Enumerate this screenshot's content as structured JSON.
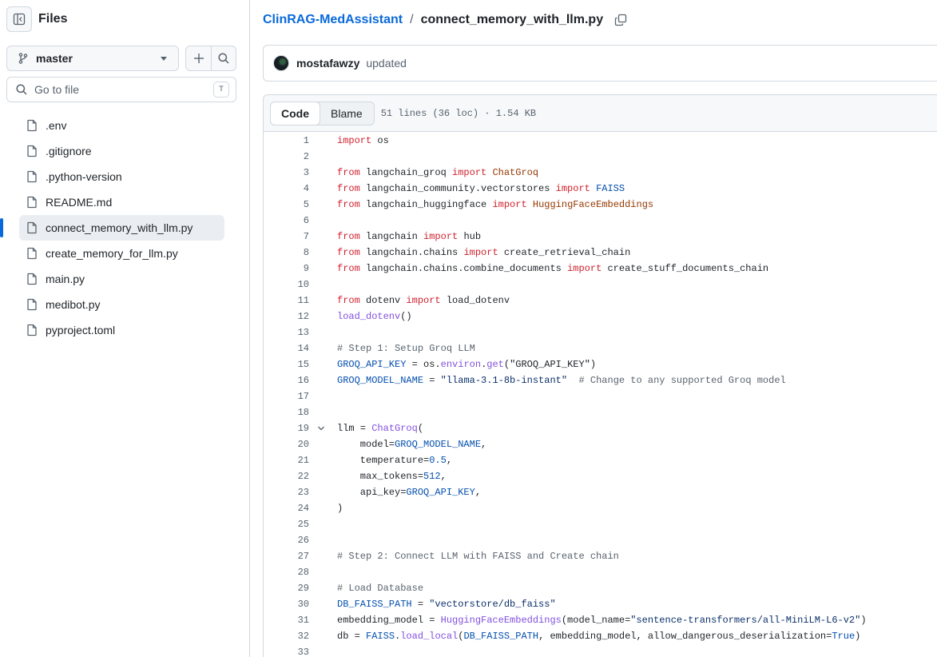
{
  "sidebar": {
    "title": "Files",
    "branch": "master",
    "search_placeholder": "Go to file",
    "search_shortcut": "T",
    "files": [
      {
        "name": ".env",
        "active": false
      },
      {
        "name": ".gitignore",
        "active": false
      },
      {
        "name": ".python-version",
        "active": false
      },
      {
        "name": "README.md",
        "active": false
      },
      {
        "name": "connect_memory_with_llm.py",
        "active": true
      },
      {
        "name": "create_memory_for_llm.py",
        "active": false
      },
      {
        "name": "main.py",
        "active": false
      },
      {
        "name": "medibot.py",
        "active": false
      },
      {
        "name": "pyproject.toml",
        "active": false
      }
    ]
  },
  "breadcrumb": {
    "repo": "ClinRAG-MedAssistant",
    "separator": "/",
    "file": "connect_memory_with_llm.py"
  },
  "commit": {
    "author": "mostafawzy",
    "message": "updated"
  },
  "file_header": {
    "tab_code": "Code",
    "tab_blame": "Blame",
    "info": "51 lines (36 loc) · 1.54 KB"
  },
  "code_lines": [
    {
      "n": "1",
      "t": [
        [
          "k",
          "import"
        ],
        [
          "p",
          " os"
        ]
      ]
    },
    {
      "n": "2",
      "t": []
    },
    {
      "n": "3",
      "t": [
        [
          "k",
          "from"
        ],
        [
          "p",
          " langchain_groq "
        ],
        [
          "k",
          "import"
        ],
        [
          "p",
          " "
        ],
        [
          "cl",
          "ChatGroq"
        ]
      ]
    },
    {
      "n": "4",
      "t": [
        [
          "k",
          "from"
        ],
        [
          "p",
          " langchain_community.vectorstores "
        ],
        [
          "k",
          "import"
        ],
        [
          "p",
          " "
        ],
        [
          "n",
          "FAISS"
        ]
      ]
    },
    {
      "n": "5",
      "t": [
        [
          "k",
          "from"
        ],
        [
          "p",
          " langchain_huggingface "
        ],
        [
          "k",
          "import"
        ],
        [
          "p",
          " "
        ],
        [
          "cl",
          "HuggingFaceEmbeddings"
        ]
      ]
    },
    {
      "n": "6",
      "t": []
    },
    {
      "n": "7",
      "t": [
        [
          "k",
          "from"
        ],
        [
          "p",
          " langchain "
        ],
        [
          "k",
          "import"
        ],
        [
          "p",
          " hub"
        ]
      ]
    },
    {
      "n": "8",
      "t": [
        [
          "k",
          "from"
        ],
        [
          "p",
          " langchain.chains "
        ],
        [
          "k",
          "import"
        ],
        [
          "p",
          " create_retrieval_chain"
        ]
      ]
    },
    {
      "n": "9",
      "t": [
        [
          "k",
          "from"
        ],
        [
          "p",
          " langchain.chains.combine_documents "
        ],
        [
          "k",
          "import"
        ],
        [
          "p",
          " create_stuff_documents_chain"
        ]
      ]
    },
    {
      "n": "10",
      "t": []
    },
    {
      "n": "11",
      "t": [
        [
          "k",
          "from"
        ],
        [
          "p",
          " dotenv "
        ],
        [
          "k",
          "import"
        ],
        [
          "p",
          " load_dotenv"
        ]
      ]
    },
    {
      "n": "12",
      "t": [
        [
          "f",
          "load_dotenv"
        ],
        [
          "p",
          "()"
        ]
      ]
    },
    {
      "n": "13",
      "t": []
    },
    {
      "n": "14",
      "t": [
        [
          "c",
          "# Step 1: Setup Groq LLM"
        ]
      ]
    },
    {
      "n": "15",
      "t": [
        [
          "n",
          "GROQ_API_KEY"
        ],
        [
          "p",
          " = os."
        ],
        [
          "f",
          "environ"
        ],
        [
          "p",
          "."
        ],
        [
          "f",
          "get"
        ],
        [
          "p",
          "(\"GROQ_API_KEY\")"
        ]
      ]
    },
    {
      "n": "16",
      "t": [
        [
          "n",
          "GROQ_MODEL_NAME"
        ],
        [
          "p",
          " = "
        ],
        [
          "s",
          "\"llama-3.1-8b-instant\""
        ],
        [
          "p",
          "  "
        ],
        [
          "c",
          "# Change to any supported Groq model"
        ]
      ]
    },
    {
      "n": "17",
      "t": []
    },
    {
      "n": "18",
      "t": []
    },
    {
      "n": "19",
      "t": [
        [
          "p",
          "llm = "
        ],
        [
          "f",
          "ChatGroq"
        ],
        [
          "p",
          "("
        ]
      ],
      "fold": true
    },
    {
      "n": "20",
      "t": [
        [
          "p",
          "    model="
        ],
        [
          "n",
          "GROQ_MODEL_NAME"
        ],
        [
          "p",
          ","
        ]
      ]
    },
    {
      "n": "21",
      "t": [
        [
          "p",
          "    temperature="
        ],
        [
          "n",
          "0.5"
        ],
        [
          "p",
          ","
        ]
      ]
    },
    {
      "n": "22",
      "t": [
        [
          "p",
          "    max_tokens="
        ],
        [
          "n",
          "512"
        ],
        [
          "p",
          ","
        ]
      ]
    },
    {
      "n": "23",
      "t": [
        [
          "p",
          "    api_key="
        ],
        [
          "n",
          "GROQ_API_KEY"
        ],
        [
          "p",
          ","
        ]
      ]
    },
    {
      "n": "24",
      "t": [
        [
          "p",
          ")"
        ]
      ]
    },
    {
      "n": "25",
      "t": []
    },
    {
      "n": "26",
      "t": []
    },
    {
      "n": "27",
      "t": [
        [
          "c",
          "# Step 2: Connect LLM with FAISS and Create chain"
        ]
      ]
    },
    {
      "n": "28",
      "t": []
    },
    {
      "n": "29",
      "t": [
        [
          "c",
          "# Load Database"
        ]
      ]
    },
    {
      "n": "30",
      "t": [
        [
          "n",
          "DB_FAISS_PATH"
        ],
        [
          "p",
          " = "
        ],
        [
          "s",
          "\"vectorstore/db_faiss\""
        ]
      ]
    },
    {
      "n": "31",
      "t": [
        [
          "p",
          "embedding_model = "
        ],
        [
          "f",
          "HuggingFaceEmbeddings"
        ],
        [
          "p",
          "(model_name="
        ],
        [
          "s",
          "\"sentence-transformers/all-MiniLM-L6-v2\""
        ],
        [
          "p",
          ")"
        ]
      ]
    },
    {
      "n": "32",
      "t": [
        [
          "p",
          "db = "
        ],
        [
          "n",
          "FAISS"
        ],
        [
          "p",
          "."
        ],
        [
          "f",
          "load_local"
        ],
        [
          "p",
          "("
        ],
        [
          "n",
          "DB_FAISS_PATH"
        ],
        [
          "p",
          ", embedding_model, allow_dangerous_deserialization="
        ],
        [
          "n",
          "True"
        ],
        [
          "p",
          ")"
        ]
      ]
    },
    {
      "n": "33",
      "t": []
    }
  ],
  "icons": {
    "collapse": "sidebar-collapse-icon",
    "branch": "git-branch-icon",
    "add": "plus-icon",
    "search": "search-icon",
    "file": "file-icon",
    "copy": "copy-icon",
    "fold": "chevron-down-icon"
  },
  "colors": {
    "accent": "#0969da",
    "keyword": "#cf222e",
    "comment": "#59636e",
    "string": "#0a3069",
    "constant": "#0550ae",
    "function": "#8250df",
    "class": "#953800"
  }
}
